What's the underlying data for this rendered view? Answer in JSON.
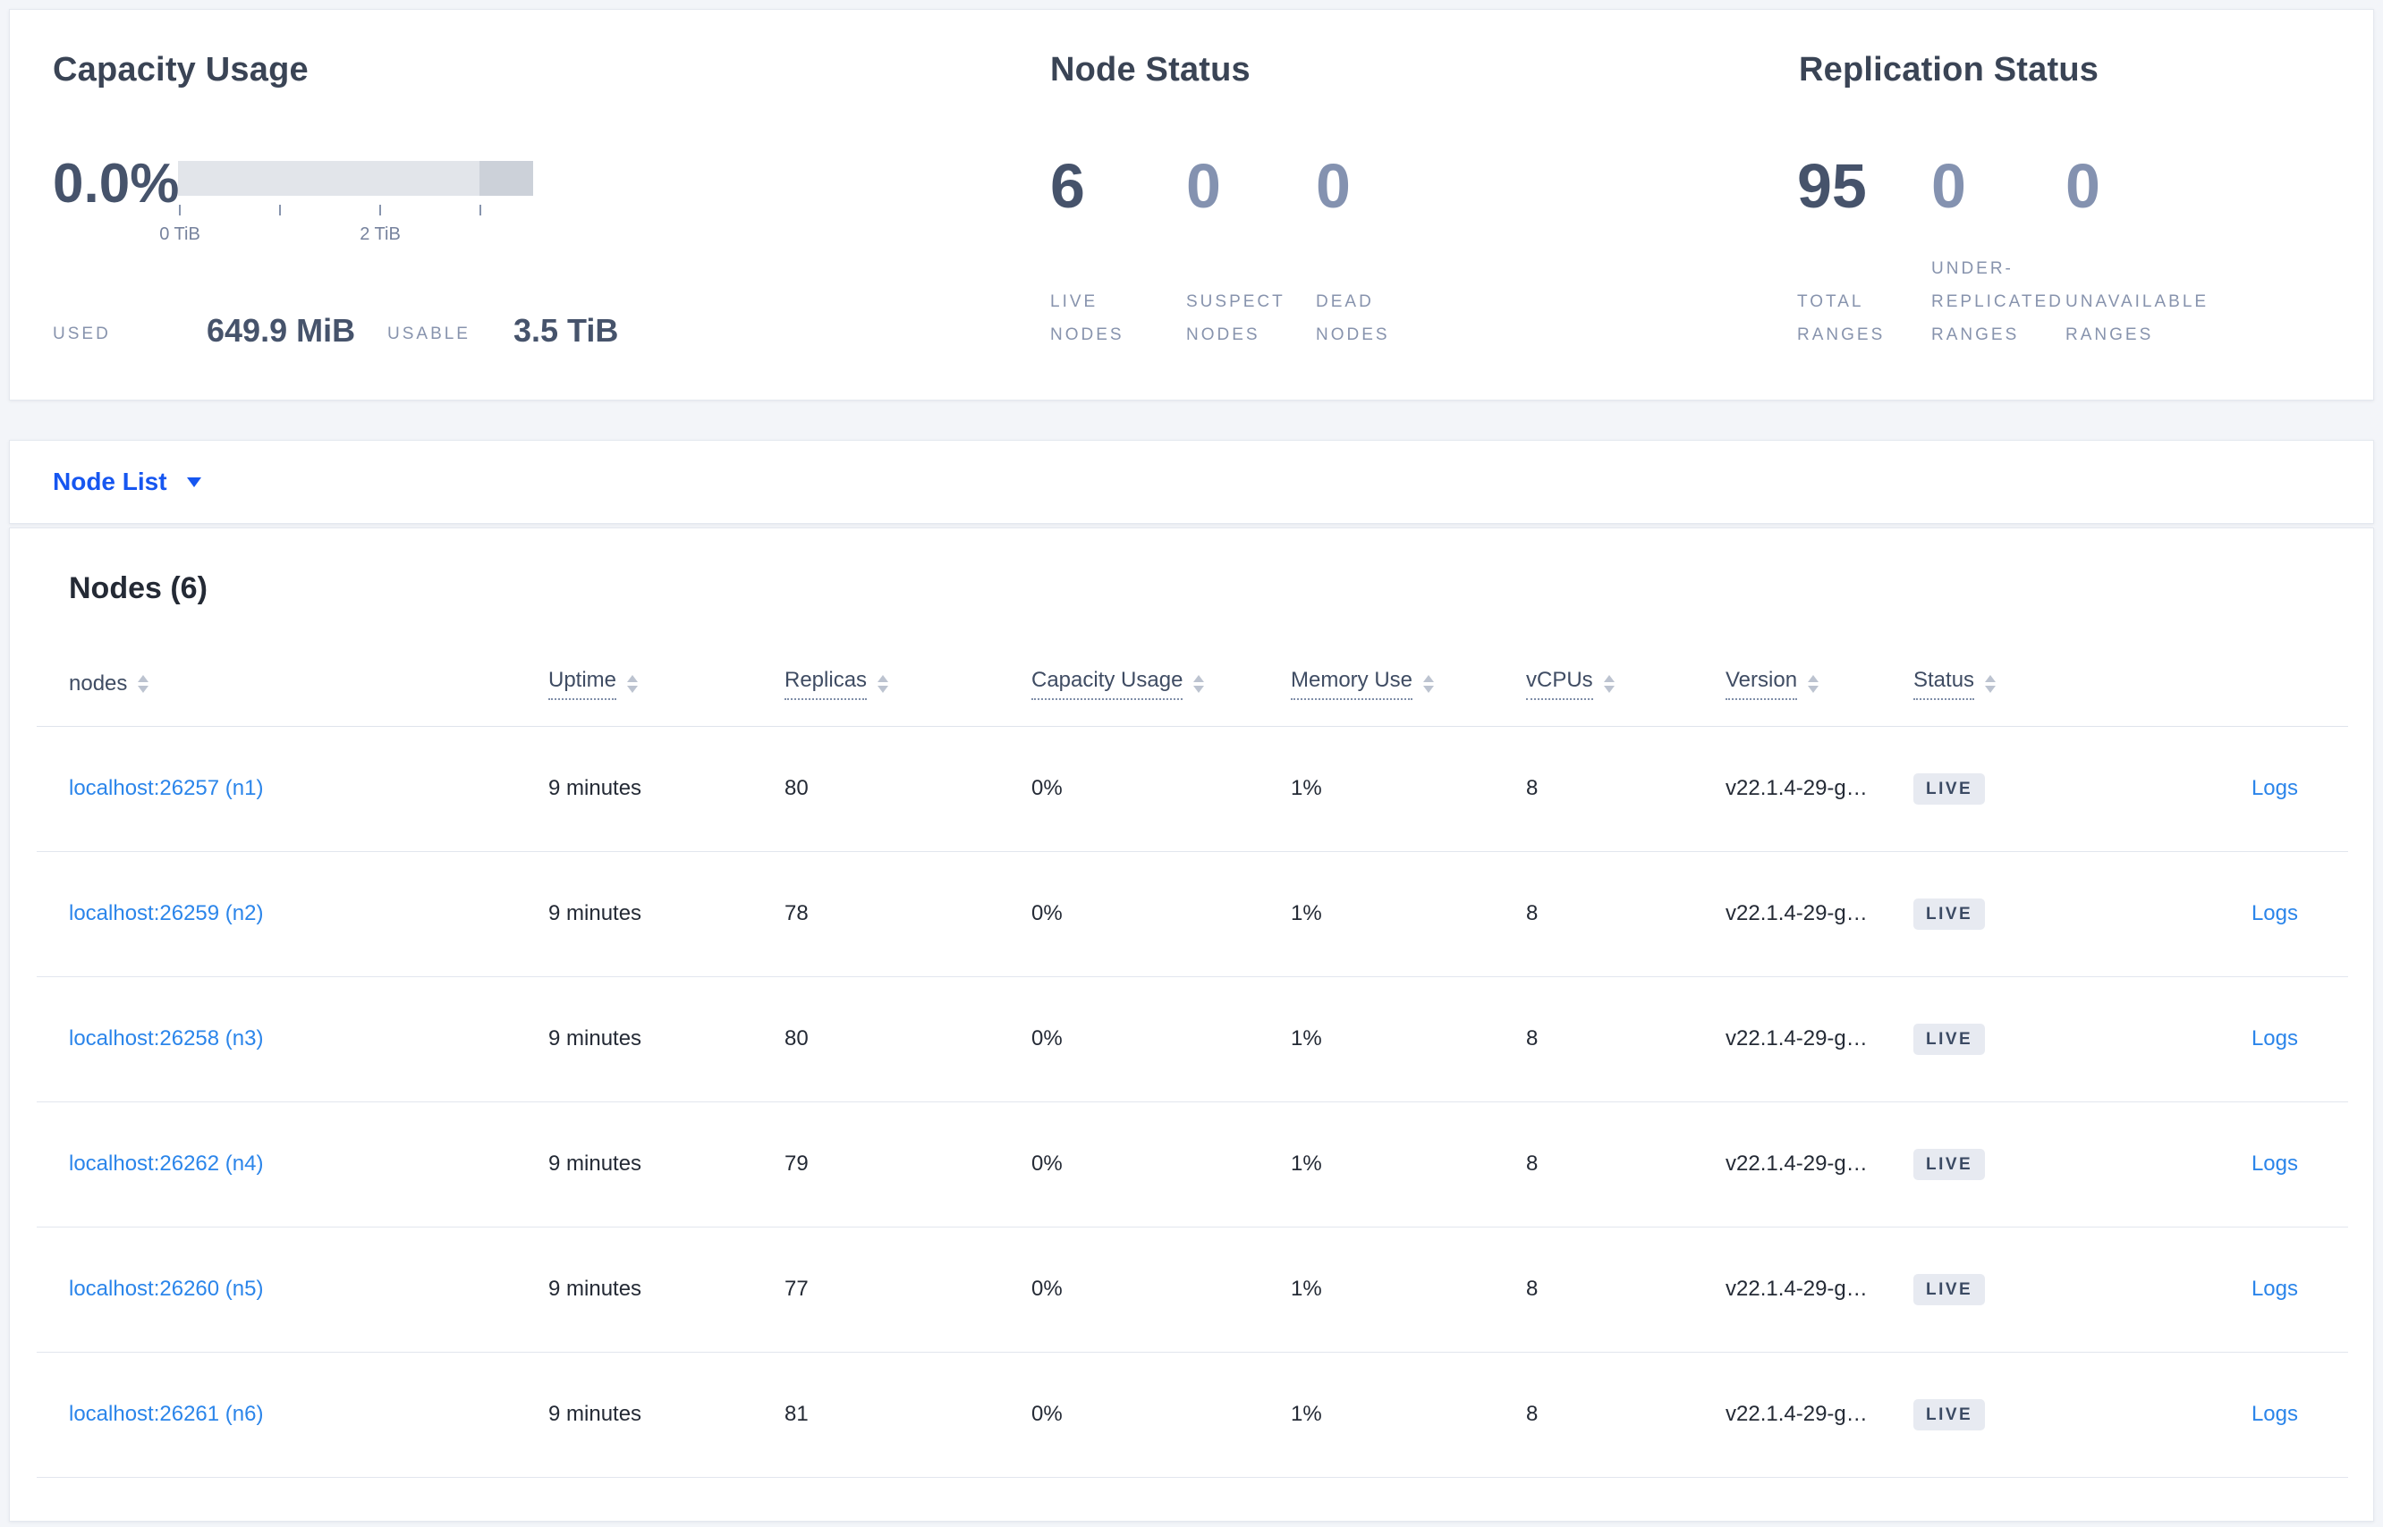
{
  "capacity_usage": {
    "title": "Capacity Usage",
    "percent": "0.0%",
    "axis_ticks": [
      "0 TiB",
      "2 TiB"
    ],
    "used_label": "USED",
    "used_value": "649.9 MiB",
    "usable_label": "USABLE",
    "usable_value": "3.5 TiB"
  },
  "node_status": {
    "title": "Node Status",
    "stats": [
      {
        "value": "6",
        "label": "LIVE NODES"
      },
      {
        "value": "0",
        "label": "SUSPECT NODES"
      },
      {
        "value": "0",
        "label": "DEAD NODES"
      }
    ]
  },
  "replication_status": {
    "title": "Replication Status",
    "stats": [
      {
        "value": "95",
        "label": "TOTAL RANGES"
      },
      {
        "value": "0",
        "label": "UNDER-REPLICATED RANGES"
      },
      {
        "value": "0",
        "label": "UNAVAILABLE RANGES"
      }
    ]
  },
  "view_selector": {
    "label": "Node List"
  },
  "nodes_table": {
    "title": "Nodes (6)",
    "columns": [
      {
        "label": "nodes"
      },
      {
        "label": "Uptime"
      },
      {
        "label": "Replicas"
      },
      {
        "label": "Capacity Usage"
      },
      {
        "label": "Memory Use"
      },
      {
        "label": "vCPUs"
      },
      {
        "label": "Version"
      },
      {
        "label": "Status"
      }
    ],
    "rows": [
      {
        "node": "localhost:26257 (n1)",
        "uptime": "9 minutes",
        "replicas": "80",
        "capacity": "0%",
        "memory": "1%",
        "vcpus": "8",
        "version": "v22.1.4-29-g…",
        "status": "LIVE",
        "logs": "Logs"
      },
      {
        "node": "localhost:26259 (n2)",
        "uptime": "9 minutes",
        "replicas": "78",
        "capacity": "0%",
        "memory": "1%",
        "vcpus": "8",
        "version": "v22.1.4-29-g…",
        "status": "LIVE",
        "logs": "Logs"
      },
      {
        "node": "localhost:26258 (n3)",
        "uptime": "9 minutes",
        "replicas": "80",
        "capacity": "0%",
        "memory": "1%",
        "vcpus": "8",
        "version": "v22.1.4-29-g…",
        "status": "LIVE",
        "logs": "Logs"
      },
      {
        "node": "localhost:26262 (n4)",
        "uptime": "9 minutes",
        "replicas": "79",
        "capacity": "0%",
        "memory": "1%",
        "vcpus": "8",
        "version": "v22.1.4-29-g…",
        "status": "LIVE",
        "logs": "Logs"
      },
      {
        "node": "localhost:26260 (n5)",
        "uptime": "9 minutes",
        "replicas": "77",
        "capacity": "0%",
        "memory": "1%",
        "vcpus": "8",
        "version": "v22.1.4-29-g…",
        "status": "LIVE",
        "logs": "Logs"
      },
      {
        "node": "localhost:26261 (n6)",
        "uptime": "9 minutes",
        "replicas": "81",
        "capacity": "0%",
        "memory": "1%",
        "vcpus": "8",
        "version": "v22.1.4-29-g…",
        "status": "LIVE",
        "logs": "Logs"
      }
    ]
  },
  "colors": {
    "accent_blue": "#1656f0",
    "link_blue": "#2b85ea",
    "bar_light": "#e2e5ea",
    "bar_dark": "#ccd1d9",
    "badge_bg": "#e7eaf1"
  }
}
